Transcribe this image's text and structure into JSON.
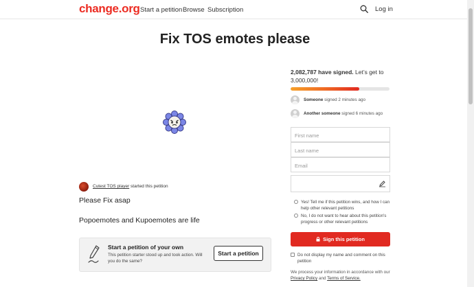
{
  "header": {
    "logo": "change.org",
    "nav": [
      "Start a petition",
      "Browse",
      "Subscription"
    ],
    "search_icon": "search-icon",
    "login": "Log in"
  },
  "petition": {
    "title": "Fix TOS emotes please",
    "image_icon": "blue-flower-emote-icon",
    "starter_name": "Cutest TOS player",
    "starter_suffix": "started this petition",
    "body_lines": [
      "Please Fix asap",
      "Popoemotes and Kupoemotes are life"
    ]
  },
  "cta": {
    "heading": "Start a petition of your own",
    "text": "This petition starter stood up and took action. Will you do the same?",
    "button": "Start a petition",
    "icon": "pen-icon"
  },
  "signatures": {
    "count": "2,082,787 have signed.",
    "goal_text": "Let’s get to 3,000,000!",
    "signed": 2082787,
    "goal": 3000000,
    "progress_fraction": 0.694,
    "recent": [
      {
        "name": "Someone",
        "action": "signed 2 minutes ago"
      },
      {
        "name": "Another someone",
        "action": "signed 6 minutes ago"
      }
    ]
  },
  "form": {
    "first_name_placeholder": "First name",
    "last_name_placeholder": "Last name",
    "email_placeholder": "Email",
    "comment_icon": "edit-icon",
    "radio_yes": "Yes! Tell me if this petition wins, and how I can help other relevant petitions",
    "radio_no": "No, I do not want to hear about this petition's progress or other relevant petitions",
    "sign_button": "Sign this petition",
    "hide_name": "Do not display my name and comment on this petition",
    "privacy_prefix": "We process your information in accordance with our",
    "privacy_link": "Privacy Policy",
    "privacy_and": "and",
    "terms_link": "Terms of Service."
  },
  "colors": {
    "brand": "#ec2c22",
    "sign_button": "#e12a21",
    "progress_start": "#f6a12a",
    "progress_end": "#e12a21"
  }
}
